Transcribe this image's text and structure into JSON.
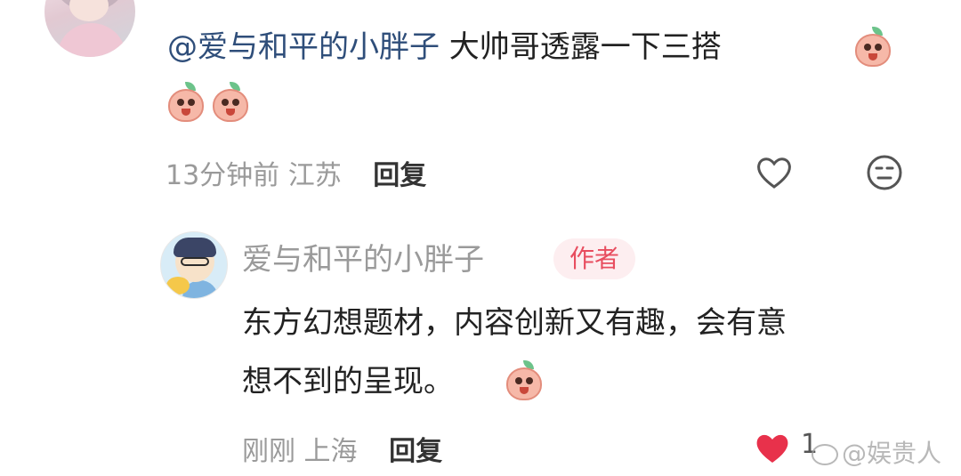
{
  "main_comment": {
    "mention": "@爱与和平的小胖子",
    "text": "  大帅哥透露一下三搭",
    "meta": {
      "time": "13分钟前",
      "location": "江苏",
      "reply_label": "回复"
    }
  },
  "reply": {
    "username": "爱与和平的小胖子",
    "badge": "作者",
    "line1": "东方幻想题材，内容创新又有趣，会有意",
    "line2": "想不到的呈现。",
    "meta": {
      "time": "刚刚",
      "location": "上海",
      "reply_label": "回复"
    },
    "like_count": "1"
  },
  "watermark": "@娱贵人",
  "icons": {
    "like": "heart-outline-icon",
    "dislike": "dislike-face-icon",
    "liked": "heart-filled-icon",
    "emoji": "peach-emoji-icon"
  },
  "colors": {
    "mention": "#2f4e7a",
    "badge_text": "#e84d5f",
    "badge_bg": "#fdeef0",
    "liked_heart": "#e8314b"
  }
}
